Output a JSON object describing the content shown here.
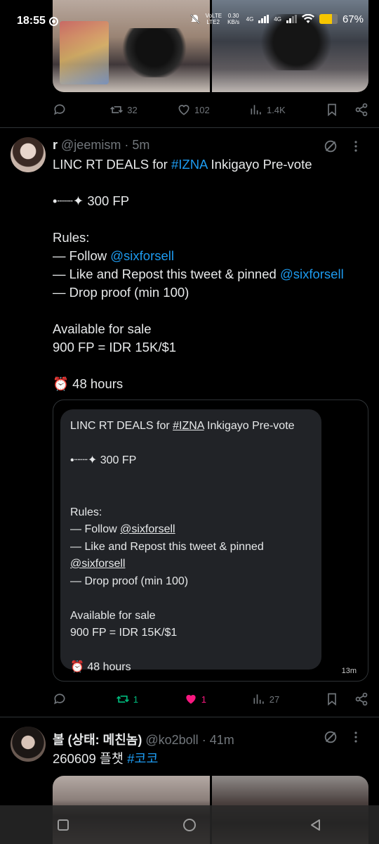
{
  "status_bar": {
    "time": "18:55",
    "network": "VoLTE LTE2",
    "speed": "0.30 KB/s",
    "signal1": "4G",
    "signal2": "4G",
    "battery": "67%"
  },
  "tweet_prev": {
    "replies": "",
    "reposts": "32",
    "likes": "102",
    "views": "1.4K"
  },
  "tweet_main": {
    "name": "r",
    "handle": "@jeemism",
    "sep": "·",
    "time": "5m",
    "lines": [
      {
        "t": "LINC RT DEALS for ",
        "link": "#IZNA",
        "after": " Inkigayo Pre-vote"
      },
      {
        "t": ""
      },
      {
        "t": "•┈┈✦ 300 FP"
      },
      {
        "t": ""
      },
      {
        "t": "Rules:"
      },
      {
        "t": "— Follow ",
        "link": "@sixforsell"
      },
      {
        "t": "— Like and Repost this tweet & pinned ",
        "link": "@sixforsell"
      },
      {
        "t": "— Drop proof (min 100)"
      },
      {
        "t": ""
      },
      {
        "t": "Available for sale"
      },
      {
        "t": "900 FP = IDR 15K/$1"
      },
      {
        "t": ""
      },
      {
        "t": "⏰ 48 hours"
      }
    ],
    "quote": {
      "lines": [
        {
          "t": "LINC RT DEALS for ",
          "u": "#IZNA",
          "after": " Inkigayo Pre-vote"
        },
        {
          "t": ""
        },
        {
          "t": "•┈┈✦ 300 FP"
        },
        {
          "t": ""
        },
        {
          "t": ""
        },
        {
          "t": "Rules:"
        },
        {
          "t": "— Follow ",
          "u": "@sixforsell"
        },
        {
          "t": "— Like and Repost this tweet & pinned"
        },
        {
          "t": "",
          "u": "@sixforsell"
        },
        {
          "t": "— Drop proof (min 100)"
        },
        {
          "t": ""
        },
        {
          "t": "Available for sale"
        },
        {
          "t": "900 FP = IDR 15K/$1"
        },
        {
          "t": ""
        },
        {
          "t": "⏰ 48 hours"
        }
      ],
      "time": "13m"
    },
    "replies": "",
    "reposts": "1",
    "likes": "1",
    "views": "27"
  },
  "tweet_next": {
    "name": "볼 (상태: 메친놈)",
    "handle": "@ko2boll",
    "sep": "·",
    "time": "41m",
    "text": "260609 플챗 ",
    "link": "#코코"
  },
  "colors": {
    "background": "#000000",
    "link": "#1d9bf0",
    "repost_active": "#00ba7c",
    "like_active": "#f91880",
    "muted": "#71767b"
  }
}
